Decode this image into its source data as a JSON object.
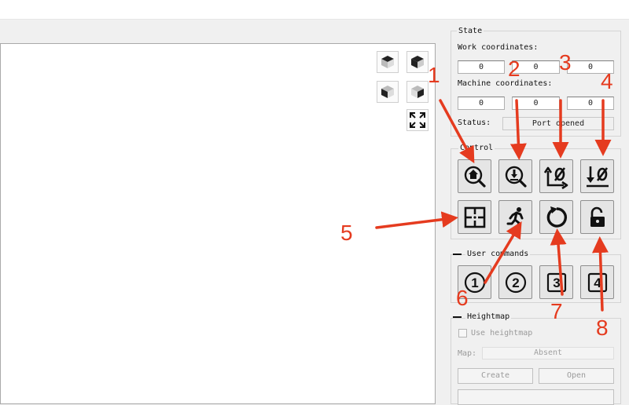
{
  "state": {
    "title": "State",
    "work_label": "Work coordinates:",
    "work": [
      "0",
      "0",
      "0"
    ],
    "machine_label": "Machine coordinates:",
    "machine": [
      "0",
      "0",
      "0"
    ],
    "status_label": "Status:",
    "status_value": "Port opened"
  },
  "control": {
    "title": "Control",
    "buttons": [
      "home-icon",
      "probe-icon",
      "zero-xy-icon",
      "zero-z-icon",
      "crosshair-icon",
      "running-man-icon",
      "reset-icon",
      "unlock-icon"
    ]
  },
  "user_commands": {
    "title": "User commands",
    "buttons": [
      "1",
      "2",
      "3",
      "4"
    ]
  },
  "heightmap": {
    "title": "Heightmap",
    "use_label": "Use heightmap",
    "map_label": "Map:",
    "map_value": "Absent",
    "create_label": "Create",
    "open_label": "Open"
  },
  "annotations": [
    "1",
    "2",
    "3",
    "4",
    "5",
    "6",
    "7",
    "8"
  ],
  "annotation_color": "#e53b1f"
}
